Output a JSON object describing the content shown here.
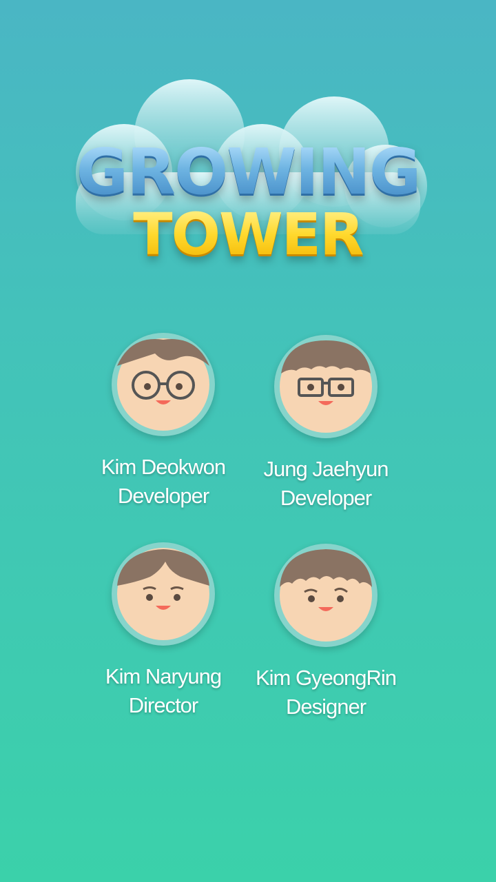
{
  "logo": {
    "line1": "GROWING",
    "line2": "TOWER"
  },
  "credits": [
    {
      "name": "Kim Deokwon",
      "role": "Developer"
    },
    {
      "name": "Jung Jaehyun",
      "role": "Developer"
    },
    {
      "name": "Kim Naryung",
      "role": "Director"
    },
    {
      "name": "Kim GyeongRin",
      "role": "Designer"
    }
  ],
  "colors": {
    "skin": "#f7d5b3",
    "hair": "#8a7363",
    "ring": "#86d4cb"
  }
}
